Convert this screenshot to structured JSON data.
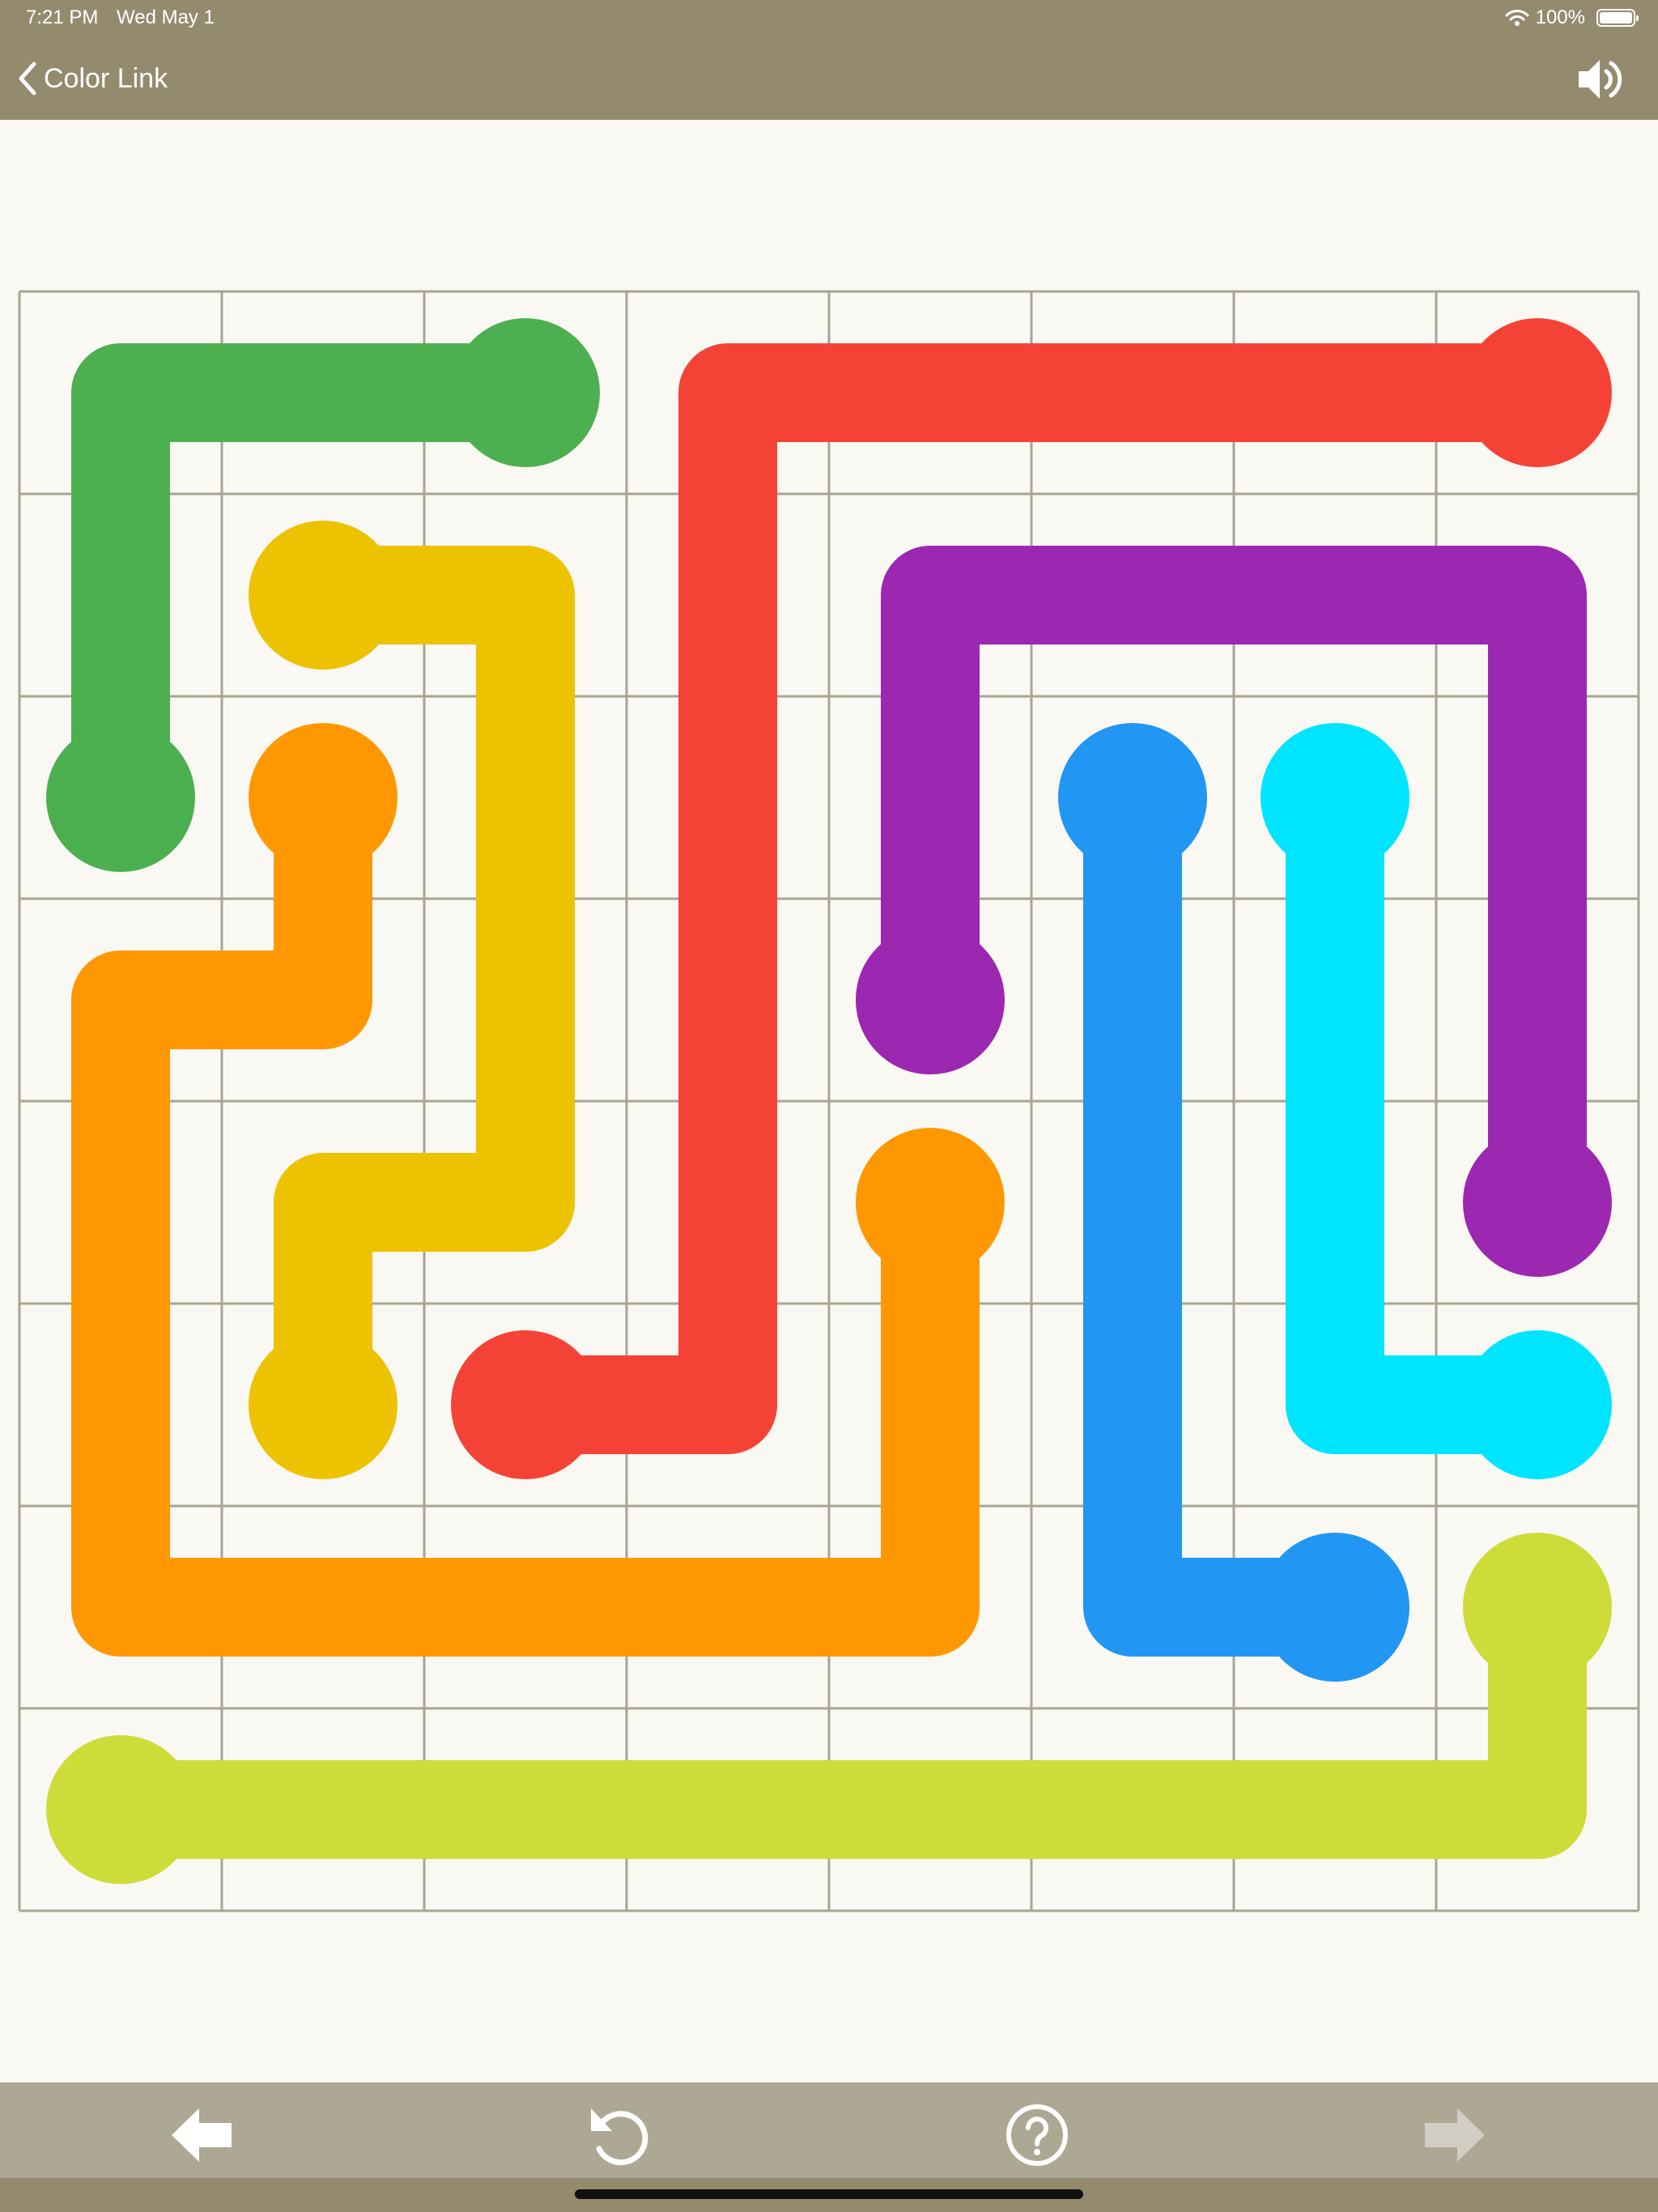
{
  "status_bar": {
    "time": "7:21 PM",
    "date": "Wed May 1",
    "battery": "100%"
  },
  "nav": {
    "title": "Color Link",
    "back_icon": "chevron-left-icon",
    "sound_icon": "speaker-icon"
  },
  "board": {
    "rows": 8,
    "cols": 8,
    "grid_color": "#a8a594",
    "flows": [
      {
        "color_name": "green",
        "color": "#4caf50",
        "path": [
          [
            2,
            0
          ],
          [
            1,
            0
          ],
          [
            0,
            0
          ],
          [
            0,
            1
          ],
          [
            0,
            2
          ]
        ]
      },
      {
        "color_name": "red",
        "color": "#f44336",
        "path": [
          [
            0,
            7
          ],
          [
            0,
            6
          ],
          [
            0,
            5
          ],
          [
            0,
            4
          ],
          [
            0,
            3
          ],
          [
            1,
            3
          ],
          [
            2,
            3
          ],
          [
            3,
            3
          ],
          [
            4,
            3
          ],
          [
            5,
            3
          ],
          [
            5,
            2
          ]
        ]
      },
      {
        "color_name": "yellow",
        "color": "#edc200",
        "path": [
          [
            1,
            1
          ],
          [
            1,
            2
          ],
          [
            2,
            2
          ],
          [
            3,
            2
          ],
          [
            4,
            2
          ],
          [
            4,
            1
          ],
          [
            5,
            1
          ]
        ]
      },
      {
        "color_name": "orange",
        "color": "#ff9800",
        "path": [
          [
            2,
            1
          ],
          [
            3,
            1
          ],
          [
            3,
            0
          ],
          [
            4,
            0
          ],
          [
            5,
            0
          ],
          [
            6,
            0
          ],
          [
            6,
            1
          ],
          [
            6,
            2
          ],
          [
            6,
            3
          ],
          [
            6,
            4
          ],
          [
            5,
            4
          ],
          [
            4,
            4
          ]
        ]
      },
      {
        "color_name": "purple",
        "color": "#9c27b0",
        "path": [
          [
            3,
            4
          ],
          [
            2,
            4
          ],
          [
            1,
            4
          ],
          [
            1,
            5
          ],
          [
            1,
            6
          ],
          [
            1,
            7
          ],
          [
            2,
            7
          ],
          [
            3,
            7
          ],
          [
            4,
            7
          ]
        ]
      },
      {
        "color_name": "blue",
        "color": "#2196f3",
        "path": [
          [
            2,
            5
          ],
          [
            3,
            5
          ],
          [
            4,
            5
          ],
          [
            5,
            5
          ],
          [
            6,
            5
          ],
          [
            6,
            6
          ]
        ]
      },
      {
        "color_name": "cyan",
        "color": "#00e5ff",
        "path": [
          [
            2,
            6
          ],
          [
            3,
            6
          ],
          [
            4,
            6
          ],
          [
            5,
            6
          ],
          [
            5,
            7
          ]
        ]
      },
      {
        "color_name": "lime",
        "color": "#cddc39",
        "path": [
          [
            6,
            7
          ],
          [
            7,
            7
          ],
          [
            7,
            6
          ],
          [
            7,
            5
          ],
          [
            7,
            4
          ],
          [
            7,
            3
          ],
          [
            7,
            2
          ],
          [
            7,
            1
          ],
          [
            7,
            0
          ]
        ]
      }
    ]
  },
  "toolbar": {
    "items": [
      {
        "name": "previous-level-button",
        "icon": "arrow-left-icon",
        "enabled": true
      },
      {
        "name": "restart-button",
        "icon": "restart-icon",
        "enabled": true
      },
      {
        "name": "help-button",
        "icon": "help-icon",
        "enabled": true
      },
      {
        "name": "next-level-button",
        "icon": "arrow-right-icon",
        "enabled": false
      }
    ]
  }
}
